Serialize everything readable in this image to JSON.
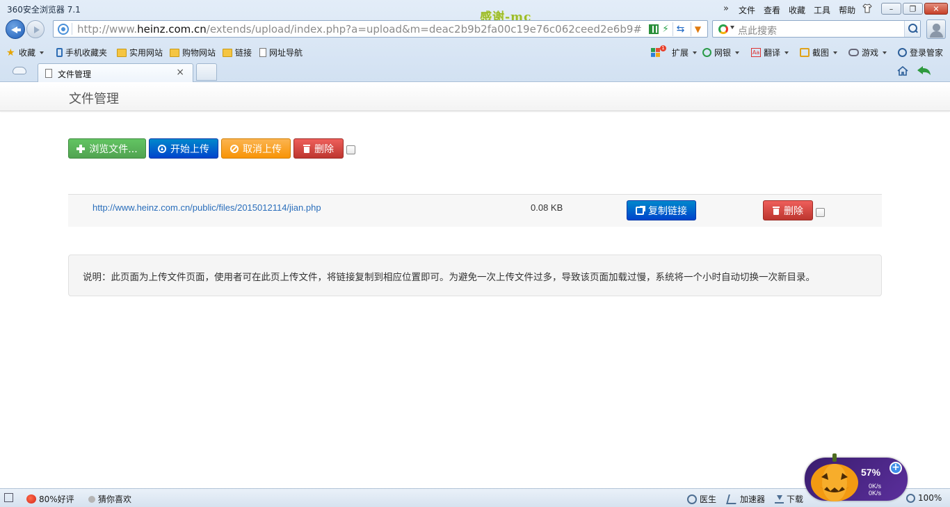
{
  "browser": {
    "title": "360安全浏览器 7.1",
    "watermark": "感谢-mc",
    "menu": [
      "文件",
      "查看",
      "收藏",
      "工具",
      "帮助"
    ],
    "address": {
      "prefix": "http://www.",
      "domain": "heinz.com.cn",
      "path": "/extends/upload/index.php?a=upload&m=deac2b9b2fa00c19e76c062ceed2e6b9#"
    },
    "search_placeholder": "点此搜索",
    "bookmarks": {
      "favorites": "收藏",
      "mobile": "手机收藏夹",
      "useful": "实用网站",
      "shopping": "购物网站",
      "links": "链接",
      "nav": "网址导航"
    },
    "tools": {
      "extensions": "扩展",
      "extensions_badge": "1",
      "bank": "网银",
      "translate": "翻译",
      "translate_icon_text": "Aa",
      "screenshot": "截图",
      "games": "游戏",
      "login": "登录管家"
    },
    "tab_label": "文件管理",
    "accent": "#1f5eb8"
  },
  "page": {
    "title": "文件管理",
    "toolbar": {
      "browse": "浏览文件...",
      "start": "开始上传",
      "cancel": "取消上传",
      "delete": "删除"
    },
    "file": {
      "url": "http://www.heinz.com.cn/public/files/2015012114/jian.php",
      "size": "0.08 KB",
      "copy_link": "复制链接",
      "delete": "删除"
    },
    "note": "说明：此页面为上传文件页面，使用者可在此页上传文件，将链接复制到相应位置即可。为避免一次上传文件过多，导致该页面加载过慢，系统将一个小时自动切换一次新目录。",
    "colors": {
      "green": "#51a351",
      "blue": "#0044cc",
      "orange": "#f89406",
      "red": "#bd362f",
      "link": "#2a6ebb"
    }
  },
  "statusbar": {
    "rating": "80%好评",
    "guess": "猜你喜欢",
    "doctor": "医生",
    "accelerator": "加速器",
    "download": "下载",
    "zoom": "100%"
  },
  "widget": {
    "percent": "57%",
    "upload_speed": "0K/s",
    "download_speed": "0K/s"
  }
}
